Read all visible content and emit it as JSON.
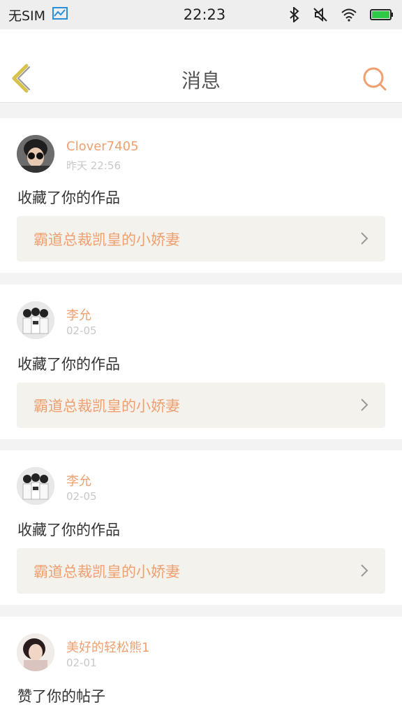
{
  "status_bar": {
    "carrier": "无SIM",
    "time": "22:23"
  },
  "nav": {
    "title": "消息"
  },
  "colors": {
    "accent": "#f0a070",
    "back_arrow": "#d8c24a",
    "card_bg": "#f3f2ec"
  },
  "messages": [
    {
      "name": "Clover7405",
      "time": "昨天 22:56",
      "action": "收藏了你的作品",
      "card_title": "霸道总裁凯皇的小娇妻"
    },
    {
      "name": "李允",
      "time": "02-05",
      "action": "收藏了你的作品",
      "card_title": "霸道总裁凯皇的小娇妻"
    },
    {
      "name": "李允",
      "time": "02-05",
      "action": "收藏了你的作品",
      "card_title": "霸道总裁凯皇的小娇妻"
    },
    {
      "name": "美好的轻松熊1",
      "time": "02-01",
      "action": "赞了你的帖子"
    }
  ]
}
